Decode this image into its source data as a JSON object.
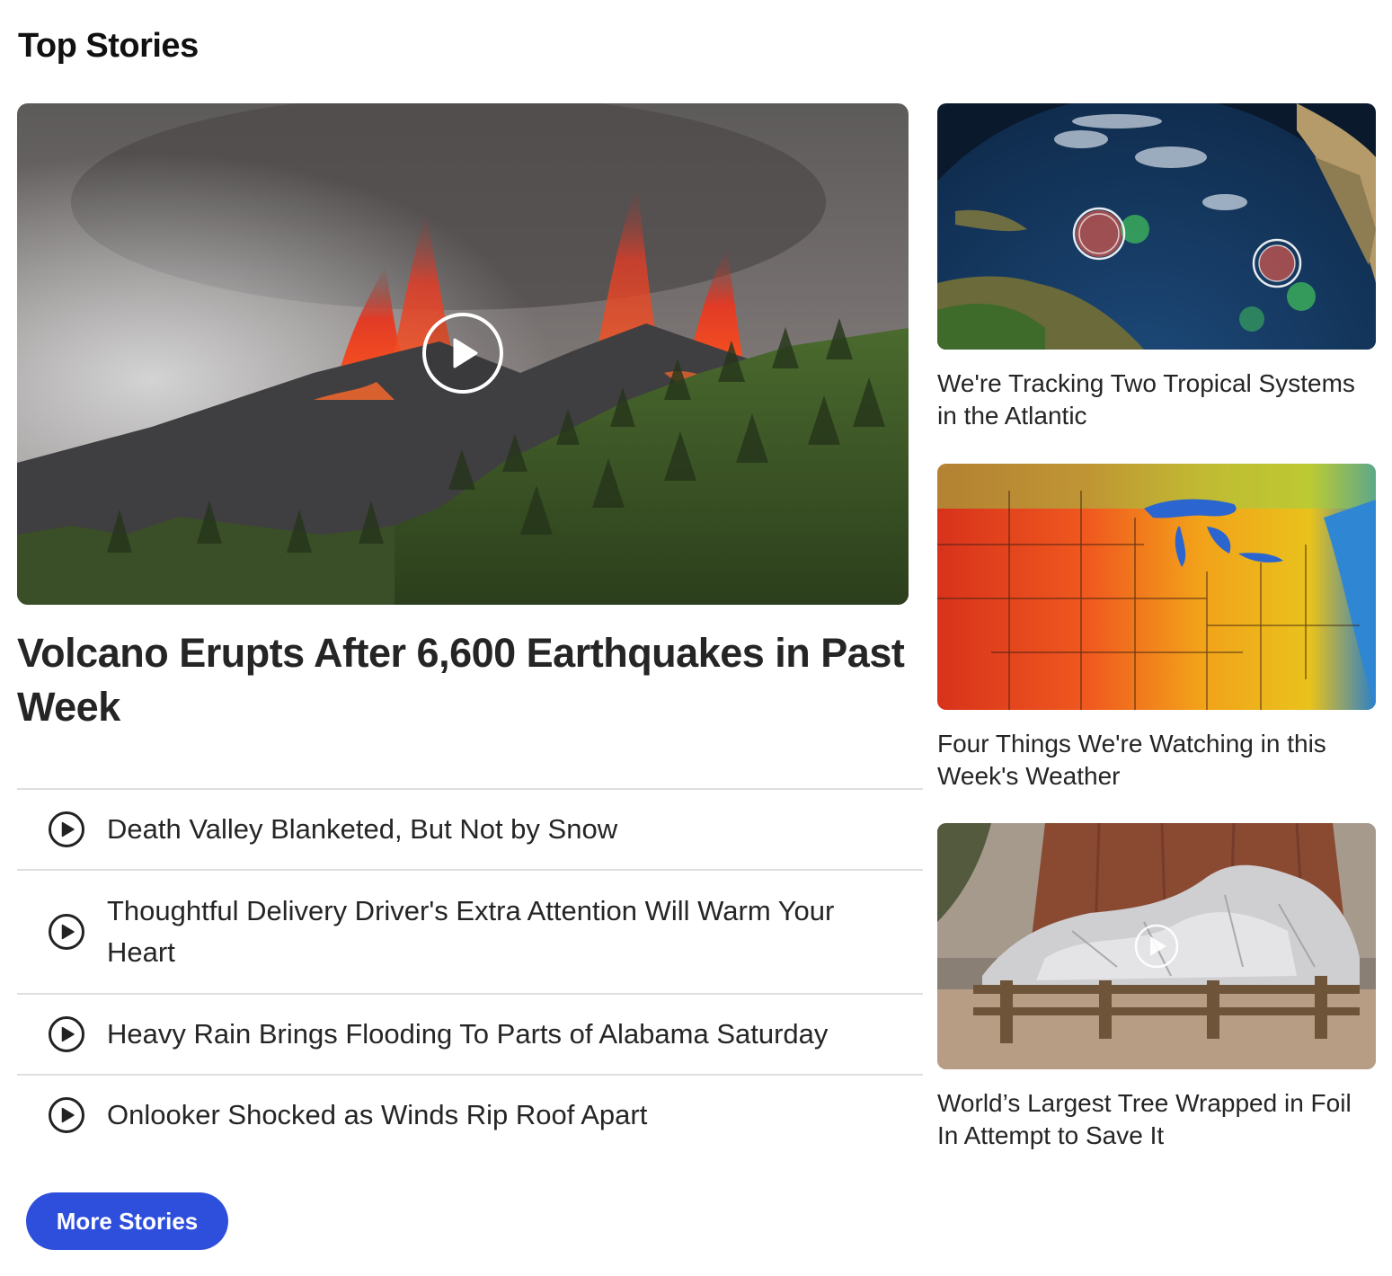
{
  "section": {
    "title": "Top Stories"
  },
  "lead_story": {
    "title": "Volcano Erupts After 6,600 Earthquakes in Past Week",
    "image": "volcano-eruption-photo",
    "has_video": true
  },
  "story_list": [
    {
      "title": "Death Valley Blanketed, But Not by Snow",
      "icon": "play-circle-icon"
    },
    {
      "title": "Thoughtful Delivery Driver's Extra Attention Will Warm Your Heart",
      "icon": "play-circle-icon"
    },
    {
      "title": "Heavy Rain Brings Flooding To Parts of Alabama Saturday",
      "icon": "play-circle-icon"
    },
    {
      "title": "Onlooker Shocked as Winds Rip Roof Apart",
      "icon": "play-circle-icon"
    }
  ],
  "side_stories": [
    {
      "title": "We're Tracking Two Tropical Systems in the Atlantic",
      "image": "atlantic-satellite-map"
    },
    {
      "title": "Four Things We're Watching in this Week's Weather",
      "image": "us-temperature-map"
    },
    {
      "title": "World’s Largest Tree Wrapped in Foil In Attempt to Save It",
      "image": "foil-wrapped-tree-photo",
      "has_video": true
    }
  ],
  "more_button": {
    "label": "More Stories"
  },
  "colors": {
    "accent": "#2e4fdc",
    "text": "#252525",
    "divider": "#dedede"
  }
}
